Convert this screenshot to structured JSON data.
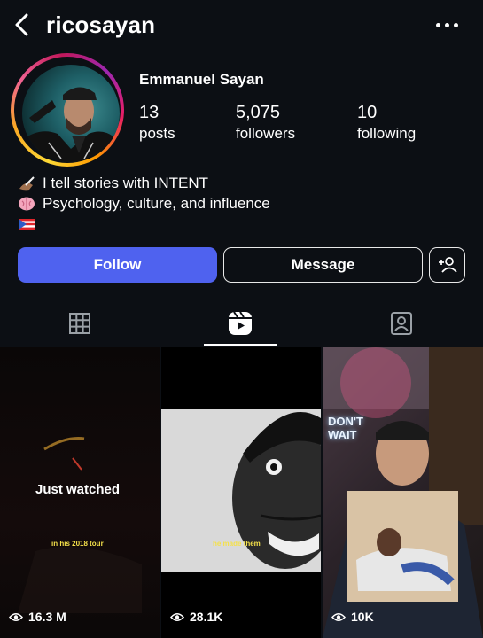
{
  "header": {
    "username": "ricosayan_"
  },
  "profile": {
    "full_name": "Emmanuel Sayan",
    "stats": [
      {
        "value": "13",
        "label": "posts"
      },
      {
        "value": "5,075",
        "label": "followers"
      },
      {
        "value": "10",
        "label": "following"
      }
    ],
    "bio": [
      {
        "icon": "writing-hand-emoji",
        "text": "I tell stories with INTENT"
      },
      {
        "icon": "brain-emoji",
        "text": "Psychology, culture, and influence"
      },
      {
        "icon": "puerto-rico-flag-emoji",
        "text": ""
      }
    ]
  },
  "actions": {
    "follow": "Follow",
    "message": "Message",
    "add_user_icon": "add-user-icon"
  },
  "tabs": [
    {
      "icon": "grid-icon",
      "active": false
    },
    {
      "icon": "reels-icon",
      "active": true
    },
    {
      "icon": "tagged-icon",
      "active": false
    }
  ],
  "reels": [
    {
      "views": "16.3 M",
      "caption": "Just watched",
      "subcaption": "in his 2018 tour"
    },
    {
      "views": "28.1K",
      "caption": "",
      "subcaption": "he made them"
    },
    {
      "views": "10K",
      "caption": "",
      "subcaption": "",
      "sign_text": "DON'T WAIT"
    }
  ],
  "colors": {
    "background": "#0c0f14",
    "follow_button": "#4f62ef",
    "subtitle_yellow": "#f5e14a"
  }
}
